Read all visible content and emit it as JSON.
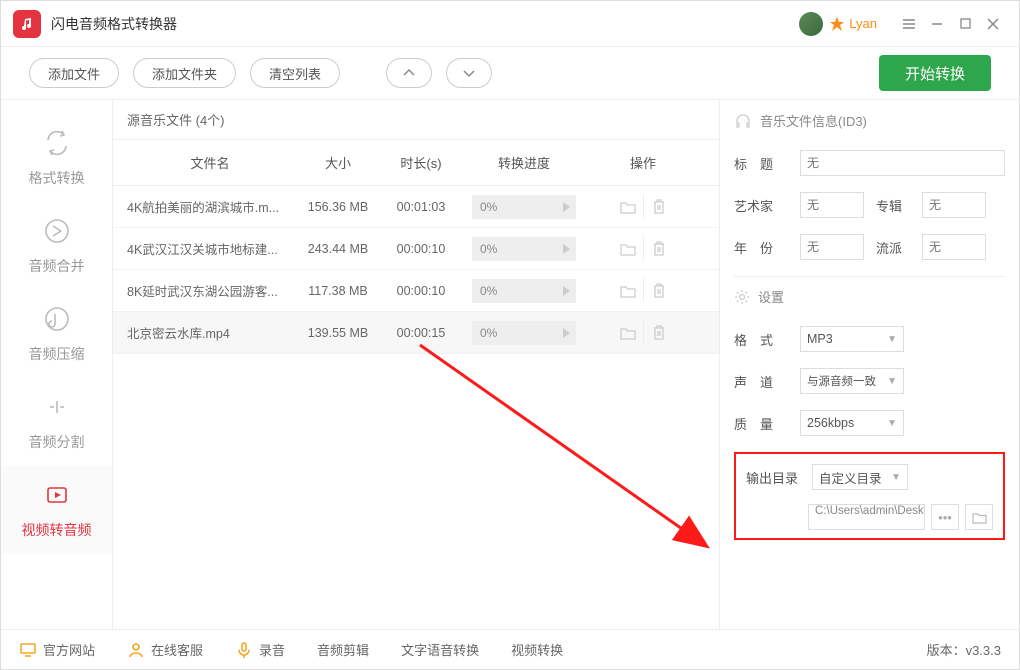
{
  "app": {
    "title": "闪电音频格式转换器",
    "username": "Lyan"
  },
  "toolbar": {
    "add_file": "添加文件",
    "add_folder": "添加文件夹",
    "clear_list": "清空列表",
    "start": "开始转换"
  },
  "sidebar": {
    "items": [
      {
        "label": "格式转换"
      },
      {
        "label": "音频合并"
      },
      {
        "label": "音频压缩"
      },
      {
        "label": "音频分割"
      },
      {
        "label": "视频转音频"
      }
    ]
  },
  "filelist": {
    "header": "源音乐文件 (4个)",
    "cols": {
      "name": "文件名",
      "size": "大小",
      "duration": "时长(s)",
      "progress": "转换进度",
      "ops": "操作"
    },
    "rows": [
      {
        "name": "4K航拍美丽的湖滨城市.m...",
        "size": "156.36 MB",
        "duration": "00:01:03",
        "progress": "0%"
      },
      {
        "name": "4K武汉江汉关城市地标建...",
        "size": "243.44 MB",
        "duration": "00:00:10",
        "progress": "0%"
      },
      {
        "name": "8K延时武汉东湖公园游客...",
        "size": "117.38 MB",
        "duration": "00:00:10",
        "progress": "0%"
      },
      {
        "name": "北京密云水库.mp4",
        "size": "139.55 MB",
        "duration": "00:00:15",
        "progress": "0%"
      }
    ]
  },
  "right": {
    "info_title": "音乐文件信息(ID3)",
    "title_lbl": "标　题",
    "title_ph": "无",
    "artist_lbl": "艺术家",
    "artist_ph": "无",
    "album_lbl": "专辑",
    "album_ph": "无",
    "year_lbl": "年　份",
    "year_ph": "无",
    "genre_lbl": "流派",
    "genre_ph": "无",
    "settings_title": "设置",
    "format_lbl": "格　式",
    "format_val": "MP3",
    "channel_lbl": "声　道",
    "channel_val": "与源音频一致",
    "quality_lbl": "质　量",
    "quality_val": "256kbps",
    "outdir_lbl": "输出目录",
    "outdir_val": "自定义目录",
    "path_val": "C:\\Users\\admin\\Desktc"
  },
  "footer": {
    "site": "官方网站",
    "cs": "在线客服",
    "rec": "录音",
    "clip": "音频剪辑",
    "txt": "文字语音转换",
    "vid": "视频转换",
    "version_lbl": "版本：",
    "version": "v3.3.3"
  }
}
